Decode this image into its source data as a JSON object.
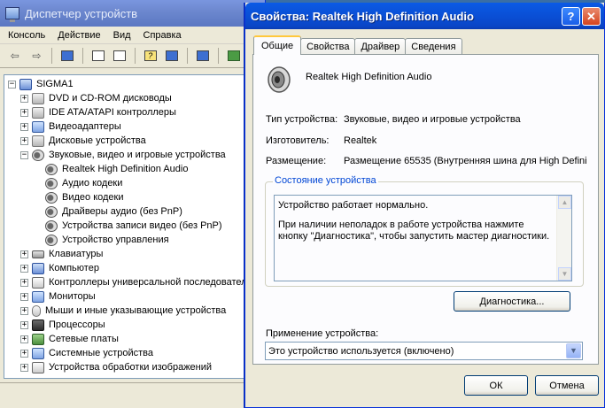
{
  "device_manager": {
    "title": "Диспетчер устройств",
    "menu": [
      "Консоль",
      "Действие",
      "Вид",
      "Справка"
    ],
    "tree": [
      {
        "label": "SIGMA1",
        "level": 0,
        "expander": "−",
        "icon": "computer-icon"
      },
      {
        "label": "DVD и CD-ROM дисководы",
        "level": 1,
        "expander": "+",
        "icon": "cdrom-icon"
      },
      {
        "label": "IDE ATA/ATAPI контроллеры",
        "level": 1,
        "expander": "+",
        "icon": "ide-controller-icon"
      },
      {
        "label": "Видеоадаптеры",
        "level": 1,
        "expander": "+",
        "icon": "display-adapter-icon"
      },
      {
        "label": "Дисковые устройства",
        "level": 1,
        "expander": "+",
        "icon": "disk-drive-icon"
      },
      {
        "label": "Звуковые, видео и игровые устройства",
        "level": 1,
        "expander": "−",
        "icon": "sound-device-icon"
      },
      {
        "label": "Realtek High Definition Audio",
        "level": 2,
        "expander": "",
        "icon": "speaker-icon"
      },
      {
        "label": "Аудио кодеки",
        "level": 2,
        "expander": "",
        "icon": "speaker-icon"
      },
      {
        "label": "Видео кодеки",
        "level": 2,
        "expander": "",
        "icon": "speaker-icon"
      },
      {
        "label": "Драйверы аудио (без PnP)",
        "level": 2,
        "expander": "",
        "icon": "speaker-icon"
      },
      {
        "label": "Устройства записи видео (без PnP)",
        "level": 2,
        "expander": "",
        "icon": "speaker-icon"
      },
      {
        "label": "Устройство управления",
        "level": 2,
        "expander": "",
        "icon": "speaker-icon"
      },
      {
        "label": "Клавиатуры",
        "level": 1,
        "expander": "+",
        "icon": "keyboard-icon"
      },
      {
        "label": "Компьютер",
        "level": 1,
        "expander": "+",
        "icon": "computer-icon"
      },
      {
        "label": "Контроллеры универсальной последовательной шины USB",
        "level": 1,
        "expander": "+",
        "icon": "usb-icon"
      },
      {
        "label": "Мониторы",
        "level": 1,
        "expander": "+",
        "icon": "monitor-icon"
      },
      {
        "label": "Мыши и иные указывающие устройства",
        "level": 1,
        "expander": "+",
        "icon": "mouse-icon"
      },
      {
        "label": "Процессоры",
        "level": 1,
        "expander": "+",
        "icon": "cpu-icon"
      },
      {
        "label": "Сетевые платы",
        "level": 1,
        "expander": "+",
        "icon": "network-card-icon"
      },
      {
        "label": "Системные устройства",
        "level": 1,
        "expander": "+",
        "icon": "system-device-icon"
      },
      {
        "label": "Устройства обработки изображений",
        "level": 1,
        "expander": "+",
        "icon": "imaging-device-icon"
      }
    ]
  },
  "dialog": {
    "title": "Свойства: Realtek High Definition Audio",
    "help_button": "?",
    "close_button": "✕",
    "tabs": [
      "Общие",
      "Свойства",
      "Драйвер",
      "Сведения"
    ],
    "active_tab": "Общие",
    "device_name": "Realtek High Definition Audio",
    "properties": [
      {
        "label": "Тип устройства:",
        "value": "Звуковые, видео и игровые устройства"
      },
      {
        "label": "Изготовитель:",
        "value": "Realtek"
      },
      {
        "label": "Размещение:",
        "value": "Размещение 65535 (Внутренняя шина для High Defini"
      }
    ],
    "status_group_title": "Состояние устройства",
    "status_line1": "Устройство работает нормально.",
    "status_line2": "При наличии неполадок в работе устройства нажмите кнопку \"Диагностика\", чтобы запустить мастер диагностики.",
    "diagnostics_button": "Диагностика...",
    "usage_label": "Применение устройства:",
    "usage_value": "Это устройство используется (включено)",
    "ok_button": "ОК",
    "cancel_button": "Отмена"
  },
  "colors": {
    "title_active": "#0a4fd6",
    "title_inactive": "#7a96df",
    "window_face": "#ece9d8",
    "group_title": "#0046d5"
  }
}
